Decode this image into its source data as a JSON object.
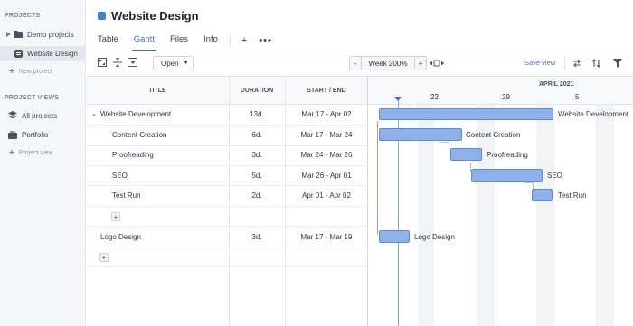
{
  "sidebar": {
    "projects_heading": "PROJECTS",
    "items": [
      {
        "label": "Demo projects"
      },
      {
        "label": "Website Design"
      }
    ],
    "new_project": "New project",
    "views_heading": "PROJECT VIEWS",
    "views": [
      {
        "label": "All projects"
      },
      {
        "label": "Portfolio"
      }
    ],
    "project_view": "Project view"
  },
  "header": {
    "title": "Website Design",
    "tabs": [
      {
        "label": "Table"
      },
      {
        "label": "Gantt"
      },
      {
        "label": "Files"
      },
      {
        "label": "Info"
      }
    ],
    "active_tab": "Gantt"
  },
  "toolbar": {
    "open_label": "Open",
    "zoom_label": "Week 200%",
    "zoom_minus": "-",
    "zoom_plus": "+",
    "save_view": "Save view"
  },
  "table": {
    "columns": [
      "TITLE",
      "DURATION",
      "START / END"
    ],
    "rows": [
      {
        "title": "Website Development",
        "duration": "13d.",
        "range": "Mar 17 - Apr 02"
      },
      {
        "title": "Content Creation",
        "duration": "6d.",
        "range": "Mar 17 - Mar 24"
      },
      {
        "title": "Proofreading",
        "duration": "3d.",
        "range": "Mar 24 - Mar 26"
      },
      {
        "title": "SEO",
        "duration": "5d.",
        "range": "Mar 26 - Apr 01"
      },
      {
        "title": "Test Run",
        "duration": "2d.",
        "range": "Apr 01 - Apr 02"
      },
      {
        "title": "Logo Design",
        "duration": "3d.",
        "range": "Mar 17 - Mar 19"
      }
    ],
    "add_symbol": "+"
  },
  "timeline": {
    "month_label": "APRIL 2021",
    "ticks": [
      "22",
      "29",
      "5"
    ],
    "bar_labels": [
      "Website Development",
      "Content Creation",
      "Proofreading",
      "SEO",
      "Test Run",
      "Logo Design"
    ]
  },
  "colors": {
    "accent": "#3f6fd1",
    "bar_fill": "#8fb1ea",
    "bar_border": "#5f8ad6"
  }
}
